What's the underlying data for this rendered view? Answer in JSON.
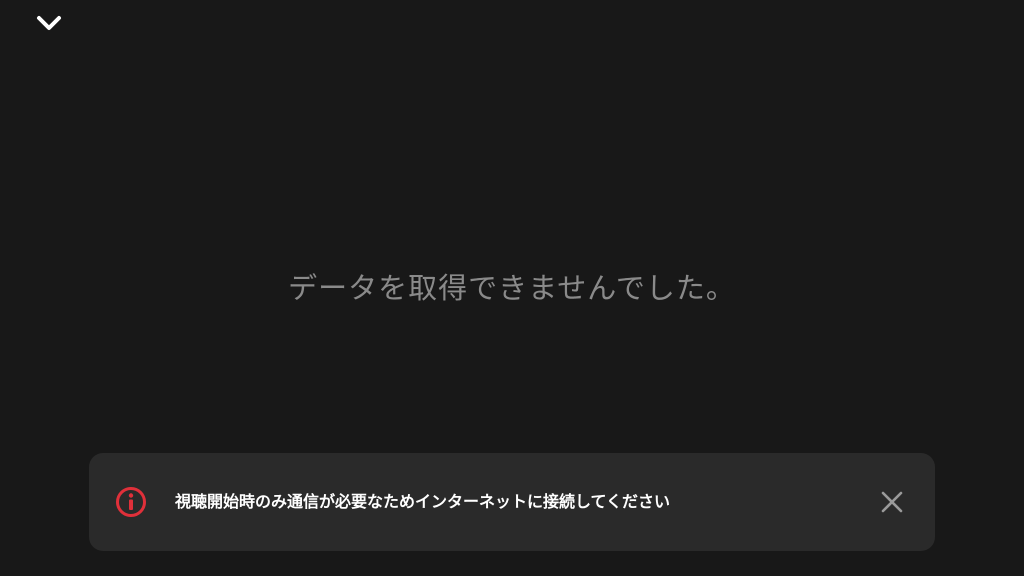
{
  "header": {
    "collapse_icon": "chevron-down-icon"
  },
  "main": {
    "empty_message": "データを取得できませんでした。"
  },
  "toast": {
    "icon": "info-icon",
    "message": "視聴開始時のみ通信が必要なためインターネットに接続してください",
    "close_icon": "close-icon"
  },
  "colors": {
    "background": "#181818",
    "toast_background": "#2a2a2a",
    "message_text": "#8a8a8a",
    "error_red": "#e0303a",
    "toast_text": "#ffffff",
    "close_icon": "#9a9a9a"
  }
}
